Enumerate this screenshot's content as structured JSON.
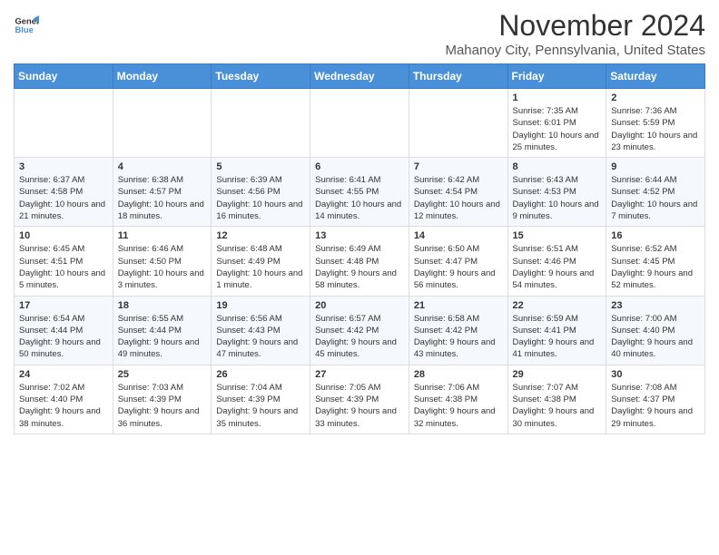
{
  "header": {
    "logo_line1": "General",
    "logo_line2": "Blue",
    "month": "November 2024",
    "location": "Mahanoy City, Pennsylvania, United States"
  },
  "weekdays": [
    "Sunday",
    "Monday",
    "Tuesday",
    "Wednesday",
    "Thursday",
    "Friday",
    "Saturday"
  ],
  "weeks": [
    [
      {
        "day": "",
        "info": ""
      },
      {
        "day": "",
        "info": ""
      },
      {
        "day": "",
        "info": ""
      },
      {
        "day": "",
        "info": ""
      },
      {
        "day": "",
        "info": ""
      },
      {
        "day": "1",
        "info": "Sunrise: 7:35 AM\nSunset: 6:01 PM\nDaylight: 10 hours and 25 minutes."
      },
      {
        "day": "2",
        "info": "Sunrise: 7:36 AM\nSunset: 5:59 PM\nDaylight: 10 hours and 23 minutes."
      }
    ],
    [
      {
        "day": "3",
        "info": "Sunrise: 6:37 AM\nSunset: 4:58 PM\nDaylight: 10 hours and 21 minutes."
      },
      {
        "day": "4",
        "info": "Sunrise: 6:38 AM\nSunset: 4:57 PM\nDaylight: 10 hours and 18 minutes."
      },
      {
        "day": "5",
        "info": "Sunrise: 6:39 AM\nSunset: 4:56 PM\nDaylight: 10 hours and 16 minutes."
      },
      {
        "day": "6",
        "info": "Sunrise: 6:41 AM\nSunset: 4:55 PM\nDaylight: 10 hours and 14 minutes."
      },
      {
        "day": "7",
        "info": "Sunrise: 6:42 AM\nSunset: 4:54 PM\nDaylight: 10 hours and 12 minutes."
      },
      {
        "day": "8",
        "info": "Sunrise: 6:43 AM\nSunset: 4:53 PM\nDaylight: 10 hours and 9 minutes."
      },
      {
        "day": "9",
        "info": "Sunrise: 6:44 AM\nSunset: 4:52 PM\nDaylight: 10 hours and 7 minutes."
      }
    ],
    [
      {
        "day": "10",
        "info": "Sunrise: 6:45 AM\nSunset: 4:51 PM\nDaylight: 10 hours and 5 minutes."
      },
      {
        "day": "11",
        "info": "Sunrise: 6:46 AM\nSunset: 4:50 PM\nDaylight: 10 hours and 3 minutes."
      },
      {
        "day": "12",
        "info": "Sunrise: 6:48 AM\nSunset: 4:49 PM\nDaylight: 10 hours and 1 minute."
      },
      {
        "day": "13",
        "info": "Sunrise: 6:49 AM\nSunset: 4:48 PM\nDaylight: 9 hours and 58 minutes."
      },
      {
        "day": "14",
        "info": "Sunrise: 6:50 AM\nSunset: 4:47 PM\nDaylight: 9 hours and 56 minutes."
      },
      {
        "day": "15",
        "info": "Sunrise: 6:51 AM\nSunset: 4:46 PM\nDaylight: 9 hours and 54 minutes."
      },
      {
        "day": "16",
        "info": "Sunrise: 6:52 AM\nSunset: 4:45 PM\nDaylight: 9 hours and 52 minutes."
      }
    ],
    [
      {
        "day": "17",
        "info": "Sunrise: 6:54 AM\nSunset: 4:44 PM\nDaylight: 9 hours and 50 minutes."
      },
      {
        "day": "18",
        "info": "Sunrise: 6:55 AM\nSunset: 4:44 PM\nDaylight: 9 hours and 49 minutes."
      },
      {
        "day": "19",
        "info": "Sunrise: 6:56 AM\nSunset: 4:43 PM\nDaylight: 9 hours and 47 minutes."
      },
      {
        "day": "20",
        "info": "Sunrise: 6:57 AM\nSunset: 4:42 PM\nDaylight: 9 hours and 45 minutes."
      },
      {
        "day": "21",
        "info": "Sunrise: 6:58 AM\nSunset: 4:42 PM\nDaylight: 9 hours and 43 minutes."
      },
      {
        "day": "22",
        "info": "Sunrise: 6:59 AM\nSunset: 4:41 PM\nDaylight: 9 hours and 41 minutes."
      },
      {
        "day": "23",
        "info": "Sunrise: 7:00 AM\nSunset: 4:40 PM\nDaylight: 9 hours and 40 minutes."
      }
    ],
    [
      {
        "day": "24",
        "info": "Sunrise: 7:02 AM\nSunset: 4:40 PM\nDaylight: 9 hours and 38 minutes."
      },
      {
        "day": "25",
        "info": "Sunrise: 7:03 AM\nSunset: 4:39 PM\nDaylight: 9 hours and 36 minutes."
      },
      {
        "day": "26",
        "info": "Sunrise: 7:04 AM\nSunset: 4:39 PM\nDaylight: 9 hours and 35 minutes."
      },
      {
        "day": "27",
        "info": "Sunrise: 7:05 AM\nSunset: 4:39 PM\nDaylight: 9 hours and 33 minutes."
      },
      {
        "day": "28",
        "info": "Sunrise: 7:06 AM\nSunset: 4:38 PM\nDaylight: 9 hours and 32 minutes."
      },
      {
        "day": "29",
        "info": "Sunrise: 7:07 AM\nSunset: 4:38 PM\nDaylight: 9 hours and 30 minutes."
      },
      {
        "day": "30",
        "info": "Sunrise: 7:08 AM\nSunset: 4:37 PM\nDaylight: 9 hours and 29 minutes."
      }
    ]
  ]
}
